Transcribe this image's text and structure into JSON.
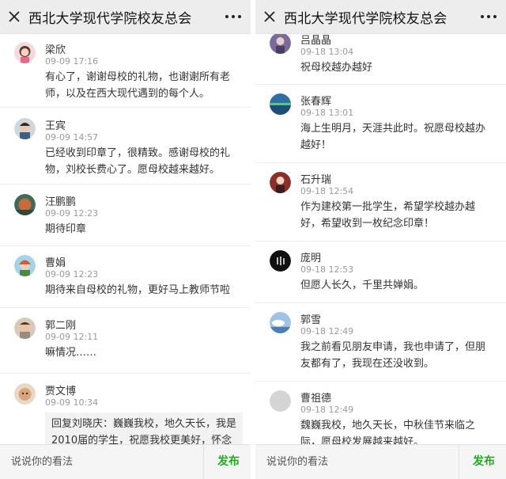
{
  "header": {
    "title": "西北大学现代学院校友总会"
  },
  "footer": {
    "placeholder": "说说你的看法",
    "publish_label": "发布"
  },
  "colors": {
    "accent_green": "#1aad19",
    "header_bg": "#ededed",
    "reply_bg": "#f2f2f2",
    "time_gray": "#9a9a9a"
  },
  "left_comments": [
    {
      "name": "梁欣",
      "time": "09-09 17:16",
      "text": "有心了，谢谢母校的礼物，也谢谢所有老师，以及在西大现代遇到的每个人。",
      "avatar": "girl-avatar"
    },
    {
      "name": "王宾",
      "time": "09-09 14:57",
      "text": "已经收到印章了，很精致。感谢母校的礼物，刘校长费心了。愿母校越来越好。",
      "avatar": "boy-avatar"
    },
    {
      "name": "汪鹏鹏",
      "time": "09-09 12:23",
      "text": "期待印章",
      "avatar": "landscape-avatar"
    },
    {
      "name": "曹娟",
      "time": "09-09 12:23",
      "text": "期待来自母校的礼物，更好马上教师节啦",
      "avatar": "cartoon-avatar"
    },
    {
      "name": "郭二刚",
      "time": "09-09 12:11",
      "text": "嘛情况……",
      "avatar": "person-avatar"
    },
    {
      "name": "贾文博",
      "time": "09-09 10:34",
      "text": "",
      "reply": "回复刘晓庆：巍巍我校，地久天长，我是2010届的学生，祝愿我校更美好，怀念曾",
      "avatar": "face-avatar"
    }
  ],
  "right_comments": [
    {
      "name": "吕晶晶",
      "time": "09-18 13:04",
      "text": "祝母校越办越好",
      "avatar": "purple-avatar"
    },
    {
      "name": "张春辉",
      "time": "09-18 13:01",
      "text": "海上生明月，天涯共此时。祝愿母校越办越好！",
      "avatar": "sea-avatar"
    },
    {
      "name": "石升瑞",
      "time": "09-18 12:54",
      "text": "作为建校第一批学生，希望学校越办越好，希望收到一枚纪念印章！",
      "avatar": "silhouette-avatar"
    },
    {
      "name": "庞明",
      "time": "09-18 12:53",
      "text": "但愿人长久，千里共婵娟。",
      "avatar": "black-avatar"
    },
    {
      "name": "郭雪",
      "time": "09-18 12:49",
      "text": "我之前看见朋友申请，我也申请了，但朋友都有了，我现在还没收到。",
      "avatar": "sky-avatar"
    },
    {
      "name": "曹祖德",
      "time": "09-18 12:49",
      "text": "魏巍我校，地久天长，中秋佳节来临之际，愿母校发展越来越好。",
      "avatar": "default-avatar"
    }
  ]
}
